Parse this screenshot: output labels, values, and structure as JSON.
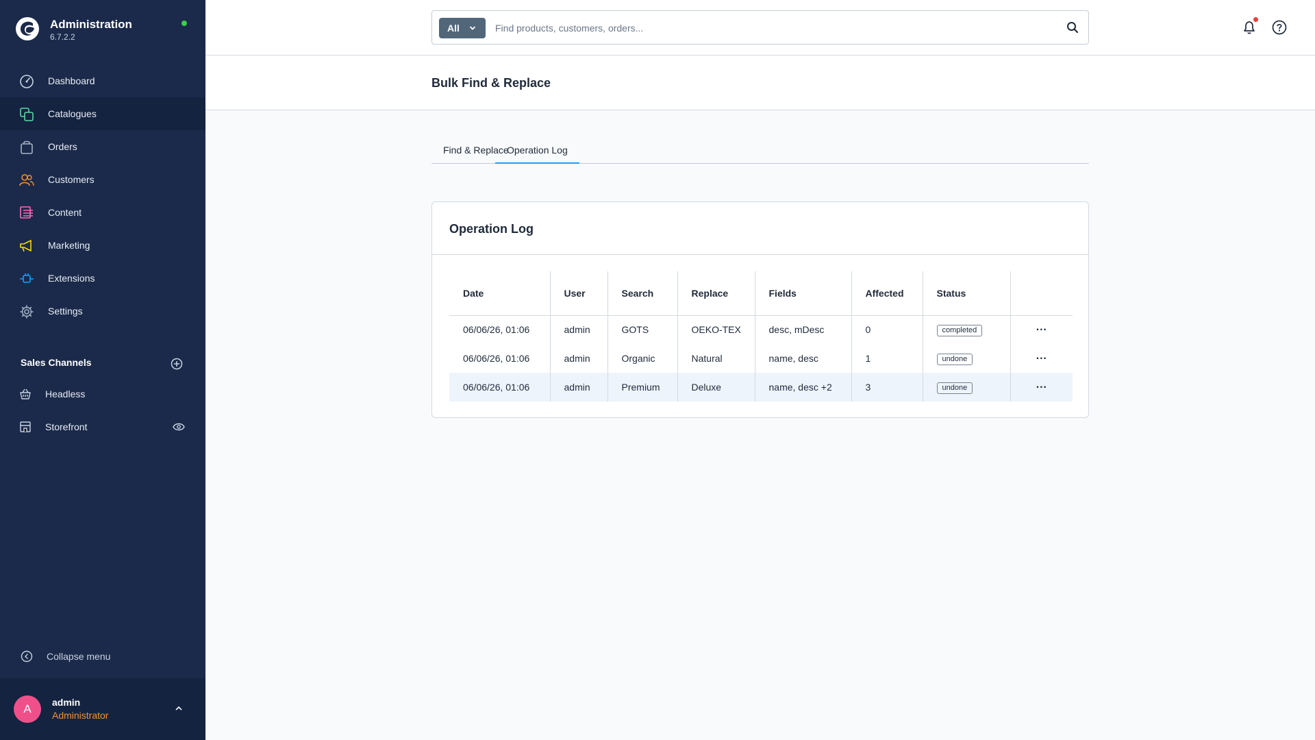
{
  "app": {
    "title": "Administration",
    "version": "6.7.2.2"
  },
  "sidebar": {
    "items": [
      {
        "label": "Dashboard",
        "icon": "gauge-icon",
        "color": "#c9d2e3"
      },
      {
        "label": "Catalogues",
        "icon": "catalogue-icon",
        "color": "#57d9a3"
      },
      {
        "label": "Orders",
        "icon": "shopping-bag-icon",
        "color": "#a7b3c6"
      },
      {
        "label": "Customers",
        "icon": "users-icon",
        "color": "#f49332"
      },
      {
        "label": "Content",
        "icon": "content-icon",
        "color": "#ff68b4"
      },
      {
        "label": "Marketing",
        "icon": "megaphone-icon",
        "color": "#ffd700"
      },
      {
        "label": "Extensions",
        "icon": "plug-icon",
        "color": "#189eff"
      },
      {
        "label": "Settings",
        "icon": "gear-icon",
        "color": "#a7b3c6"
      }
    ],
    "sales_channels_title": "Sales Channels",
    "sales_channels": [
      {
        "label": "Headless",
        "icon": "basket-icon"
      },
      {
        "label": "Storefront",
        "icon": "storefront-icon"
      }
    ],
    "collapse_label": "Collapse menu",
    "user": {
      "initial": "A",
      "name": "admin",
      "role": "Administrator"
    }
  },
  "search": {
    "type_label": "All",
    "placeholder": "Find products, customers, orders..."
  },
  "page": {
    "title": "Bulk Find & Replace"
  },
  "tabs": [
    {
      "label": "Find & Replace",
      "active": false
    },
    {
      "label": "Operation Log",
      "active": true
    }
  ],
  "card": {
    "title": "Operation Log"
  },
  "table": {
    "columns": [
      "Date",
      "User",
      "Search",
      "Replace",
      "Fields",
      "Affected",
      "Status",
      ""
    ],
    "rows": [
      {
        "date": "06/06/26, 01:06",
        "user": "admin",
        "search": "GOTS",
        "replace": "OEKO-TEX",
        "fields": "desc, mDesc",
        "affected": "0",
        "status": "completed"
      },
      {
        "date": "06/06/26, 01:06",
        "user": "admin",
        "search": "Organic",
        "replace": "Natural",
        "fields": "name, desc",
        "affected": "1",
        "status": "undone"
      },
      {
        "date": "06/06/26, 01:06",
        "user": "admin",
        "search": "Premium",
        "replace": "Deluxe",
        "fields": "name, desc +2",
        "affected": "3",
        "status": "undone"
      }
    ],
    "row_action": "···"
  },
  "colors": {
    "sidebar_bg": "#1b2a4a",
    "accent": "#189eff",
    "status_online": "#37d046"
  }
}
